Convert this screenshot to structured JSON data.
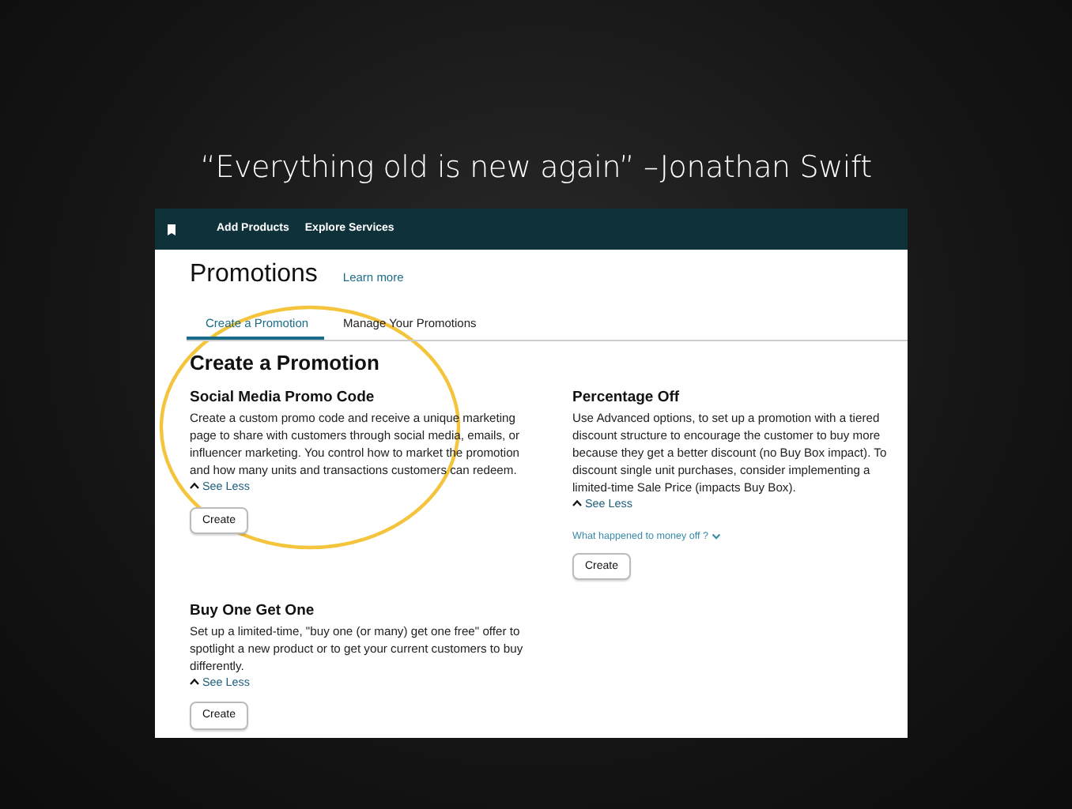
{
  "quote": "“Everything old is new again” –Jonathan Swift",
  "nav": {
    "items": [
      "Add Products",
      "Explore Services"
    ]
  },
  "page": {
    "title": "Promotions",
    "learn_more": "Learn more"
  },
  "tabs": [
    {
      "label": "Create a Promotion",
      "selected": true
    },
    {
      "label": "Manage Your Promotions",
      "selected": false
    }
  ],
  "section_title": "Create a Promotion",
  "promotions": [
    {
      "title": "Social Media Promo Code",
      "description": "Create a custom promo code and receive a unique marketing page to share with customers through social media, emails, or influencer marketing. You control how to market the promotion and how many units and transactions customers can redeem.",
      "toggle": "See Less",
      "button": "Create"
    },
    {
      "title": "Percentage Off",
      "description": "Use Advanced options, to set up a promotion with a tiered discount structure to encourage the customer to buy more because they get a better discount (no Buy Box impact). To discount single unit purchases, consider implementing a limited-time Sale Price (impacts Buy Box).",
      "toggle": "See Less",
      "link": "What happened to money off ?",
      "button": "Create"
    },
    {
      "title": "Buy One Get One",
      "description": "Set up a limited-time, \"buy one (or many) get one free\" offer to spotlight a new product or to get your current customers to buy differently.",
      "toggle": "See Less",
      "button": "Create"
    }
  ]
}
